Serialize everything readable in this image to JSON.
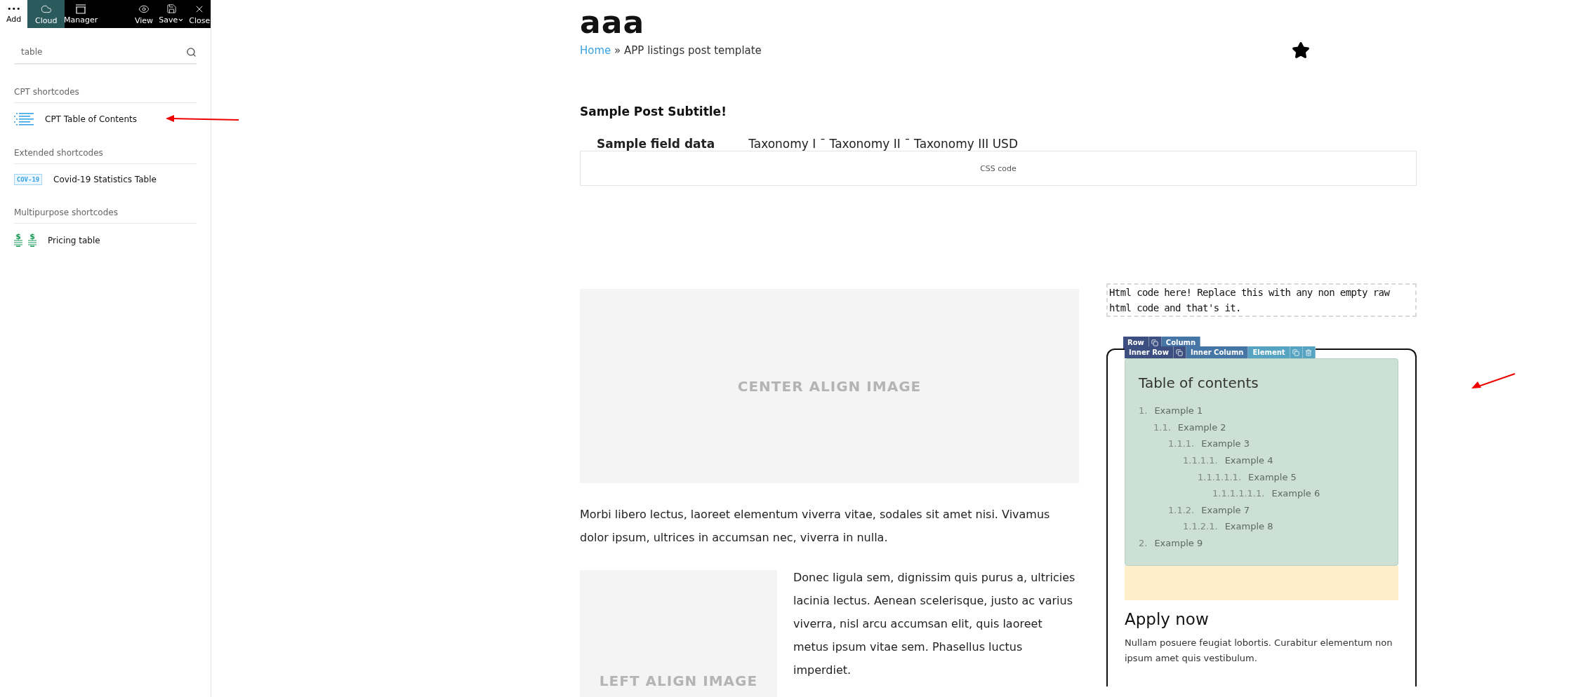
{
  "toolbar": {
    "add": {
      "label": "Add",
      "icon": "•••"
    },
    "tools": [
      {
        "label": "Cloud",
        "kind": "cloud",
        "selected": true
      },
      {
        "label": "Manager",
        "kind": "manager",
        "selected": false
      },
      {
        "label": "View",
        "kind": "view",
        "selected": false
      },
      {
        "label": "Save",
        "kind": "save",
        "selected": false
      },
      {
        "label": "Close",
        "kind": "close",
        "selected": false
      }
    ]
  },
  "search": {
    "value": "table"
  },
  "groups": [
    {
      "title": "CPT shortcodes",
      "items": [
        {
          "label": "CPT Table of Contents",
          "kind": "toc"
        }
      ]
    },
    {
      "title": "Extended shortcodes",
      "items": [
        {
          "label": "Covid-19 Statistics Table",
          "kind": "covid",
          "badge": "COV-19"
        }
      ]
    },
    {
      "title": "Multipurpose shortcodes",
      "items": [
        {
          "label": "Pricing table",
          "kind": "pricing",
          "badge": "$"
        }
      ]
    }
  ],
  "page": {
    "title": "aaa",
    "breadcrumb": {
      "home": "Home",
      "separator": "»",
      "current": "APP listings post template"
    },
    "subtitle": "Sample Post Subtitle!",
    "field": {
      "label": "Sample field data",
      "value": "Taxonomy I ¯ Taxonomy II ¯ Taxonomy III USD"
    },
    "css_box": "CSS code",
    "center_image": "CENTER ALIGN IMAGE",
    "paragraph": "Morbi libero lectus, laoreet elementum viverra vitae, sodales sit amet nisi. Vivamus dolor ipsum, ultrices in accumsan nec, viverra in nulla.",
    "left_image": "LEFT ALIGN IMAGE",
    "side_paragraph": "Donec ligula sem, dignissim quis purus a, ultricies lacinia lectus. Aenean scelerisque, justo ac varius viverra, nisl arcu accumsan elit, quis laoreet metus ipsum vitae sem. Phasellus luctus imperdiet."
  },
  "sidebar": {
    "html_box": "Html code here! Replace this with any non empty raw html code and that's it.",
    "row_bar": [
      {
        "kind": "label",
        "label": "Row",
        "color": "#3d4f80"
      },
      {
        "kind": "copy",
        "color": "#3d4f80"
      },
      {
        "kind": "label",
        "label": "Column",
        "color": "#4676a6"
      }
    ],
    "inner_bar": [
      {
        "kind": "label",
        "label": "Inner Row",
        "color": "#3d4f80"
      },
      {
        "kind": "copy",
        "color": "#3d4f80"
      },
      {
        "kind": "label",
        "label": "Inner Column",
        "color": "#4676a6"
      },
      {
        "kind": "label",
        "label": "Element",
        "color": "#57a3c2"
      },
      {
        "kind": "copy",
        "color": "#57a3c2"
      },
      {
        "kind": "delete",
        "color": "#57a3c2"
      }
    ],
    "toc": {
      "title": "Table of contents",
      "items": [
        {
          "number": "1.",
          "label": "Example 1",
          "children": [
            {
              "number": "1.1.",
              "label": "Example 2",
              "children": [
                {
                  "number": "1.1.1.",
                  "label": "Example 3",
                  "children": [
                    {
                      "number": "1.1.1.1.",
                      "label": "Example 4",
                      "children": [
                        {
                          "number": "1.1.1.1.1.",
                          "label": "Example 5",
                          "children": [
                            {
                              "number": "1.1.1.1.1.1.",
                              "label": "Example 6"
                            }
                          ]
                        }
                      ]
                    }
                  ]
                },
                {
                  "number": "1.1.2.",
                  "label": "Example 7",
                  "children": [
                    {
                      "number": "1.1.2.1.",
                      "label": "Example 8"
                    }
                  ]
                }
              ]
            }
          ]
        },
        {
          "number": "2.",
          "label": "Example 9"
        }
      ]
    },
    "apply": {
      "title": "Apply now",
      "text": "Nullam posuere feugiat lobortis. Curabitur elementum non ipsum amet quis vestibulum."
    }
  }
}
